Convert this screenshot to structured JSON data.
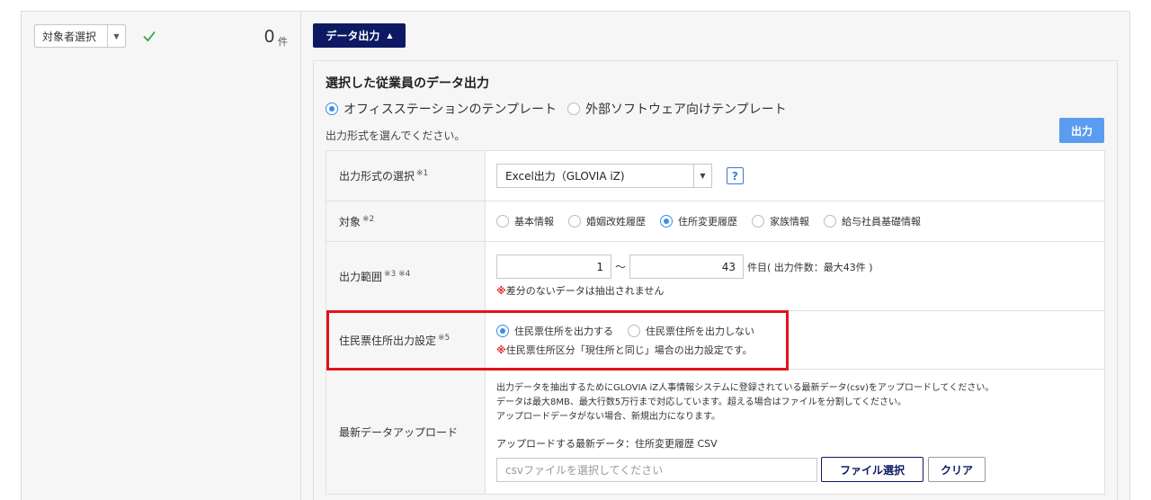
{
  "left": {
    "target_select_label": "対象者選択",
    "count_value": "0",
    "count_unit": "件"
  },
  "export_button_label": "データ出力",
  "panel": {
    "title": "選択した従業員のデータ出力",
    "template_options": [
      {
        "label": "オフィスステーションのテンプレート",
        "selected": true
      },
      {
        "label": "外部ソフトウェア向けテンプレート",
        "selected": false
      }
    ],
    "hint": "出力形式を選んでください。",
    "output_button": "出力"
  },
  "rows": {
    "format": {
      "label": "出力形式の選択",
      "sup": "※1",
      "value": "Excel出力（GLOVIA iZ)",
      "help": "?"
    },
    "target": {
      "label": "対象",
      "sup": "※2",
      "options": [
        {
          "label": "基本情報",
          "selected": false
        },
        {
          "label": "婚姻改姓履歴",
          "selected": false
        },
        {
          "label": "住所変更履歴",
          "selected": true
        },
        {
          "label": "家族情報",
          "selected": false
        },
        {
          "label": "給与社員基礎情報",
          "selected": false
        }
      ]
    },
    "range": {
      "label": "出力範囲",
      "sup": "※3 ※4",
      "from": "1",
      "tilde": "～",
      "to": "43",
      "unit": "件目( 出力件数：最大43件 )",
      "note_mark": "※",
      "note": "差分のないデータは抽出されません"
    },
    "resident": {
      "label": "住民票住所出力設定",
      "sup": "※5",
      "options": [
        {
          "label": "住民票住所を出力する",
          "selected": true
        },
        {
          "label": "住民票住所を出力しない",
          "selected": false
        }
      ],
      "note_mark": "※",
      "note": "住民票住所区分「現住所と同じ」場合の出力設定です。"
    },
    "upload": {
      "label": "最新データアップロード",
      "info1": "出力データを抽出するためにGLOVIA iZ人事情報システムに登録されている最新データ(csv)をアップロードしてください。",
      "info2": "データは最大8MB、最大行数5万行まで対応しています。超える場合はファイルを分割してください。",
      "info3": "アップロードデータがない場合、新規出力になります。",
      "upload_label": "アップロードする最新データ：住所変更履歴 CSV",
      "file_placeholder": "csvファイルを選択してください",
      "file_button": "ファイル選択",
      "clear_button": "クリア"
    }
  }
}
